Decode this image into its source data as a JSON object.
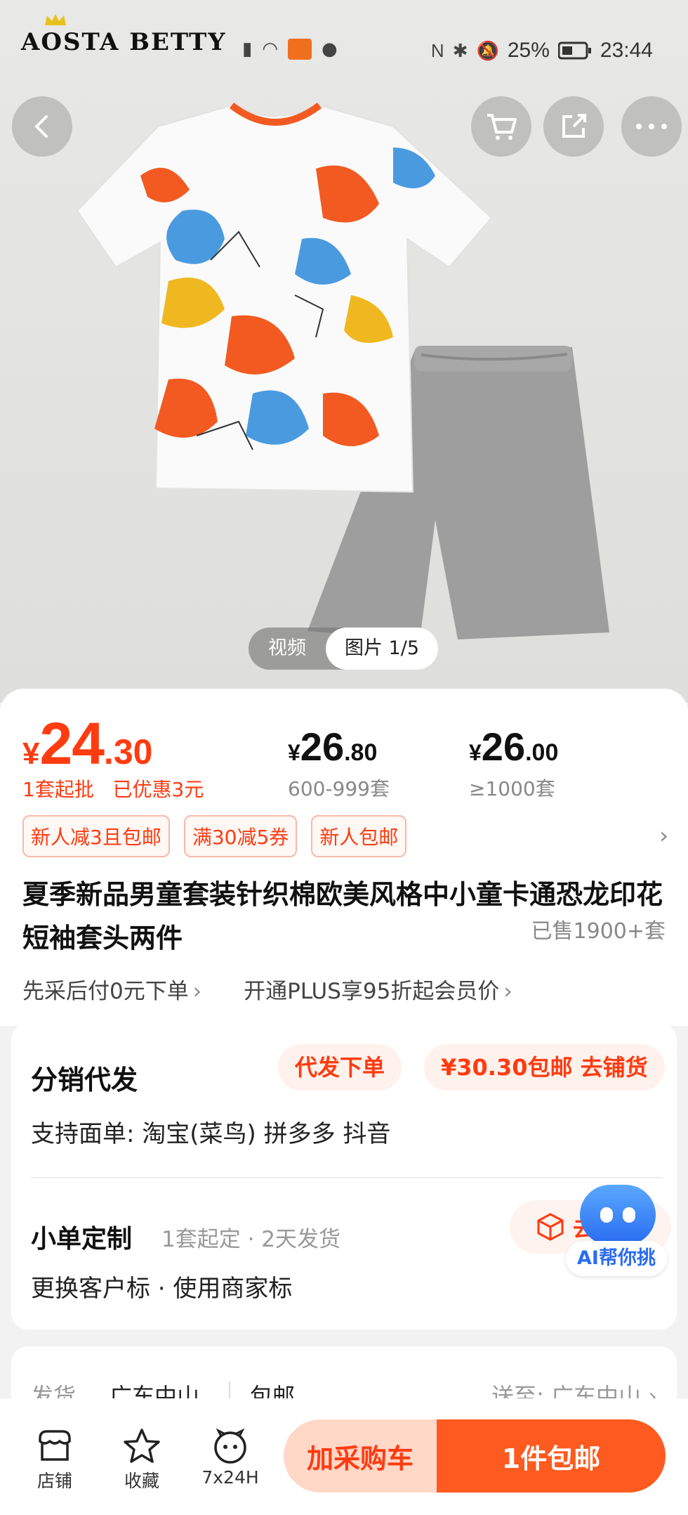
{
  "status_bar": {
    "brand": "AOSTA BETTY",
    "battery": "25%",
    "time": "23:44"
  },
  "nav": {
    "back": "back-icon",
    "cart": "cart-icon",
    "share": "share-icon",
    "more": "more-icon"
  },
  "media_toggle": {
    "video": "视频",
    "photo": "图片 1/5"
  },
  "price": {
    "currency": "¥",
    "integer": "24",
    "decimal": ".30",
    "moq": "1套起批",
    "discount": "已优惠3元",
    "tiers": [
      {
        "currency": "¥",
        "integer": "26",
        "decimal": ".80",
        "range": "600-999套"
      },
      {
        "currency": "¥",
        "integer": "26",
        "decimal": ".00",
        "range": "≥1000套"
      }
    ]
  },
  "coupons": [
    "新人减3且包邮",
    "满30减5券",
    "新人包邮"
  ],
  "product": {
    "title": "夏季新品男童套装针织棉欧美风格中小童卡通恐龙印花短袖套头两件",
    "sold": "已售1900+套"
  },
  "promos": [
    {
      "label": "先采后付0元下单"
    },
    {
      "label": "开通PLUS享95折起会员价"
    }
  ],
  "distribution": {
    "title": "分销代发",
    "dropship_button": "代发下单",
    "stock_button": "¥30.30包邮 去铺货",
    "support": "支持面单:  淘宝(菜鸟) 拼多多 抖音",
    "custom_title": "小单定制",
    "custom_meta": "1套起定 · 2天发货",
    "custom_options": "更换客户标  ·  使用商家标",
    "custom_go": "去"
  },
  "ai_assistant": {
    "label": "AI帮你挑"
  },
  "shipping": {
    "label": "发货",
    "origin": "广东中山",
    "free": "包邮",
    "to": "送至:  广东中山"
  },
  "bottom_bar": {
    "shop": "店铺",
    "favorite": "收藏",
    "service": "7x24H",
    "add_cart": "加采购车",
    "buy": "1件包邮"
  },
  "colors": {
    "accent": "#ff3b10",
    "cta": "#ff5a1f",
    "shirt_orange": "#f25a22",
    "shirt_blue": "#4a9ae0",
    "shirt_yellow": "#f0b820",
    "shorts_gray": "#9a9a9a"
  }
}
